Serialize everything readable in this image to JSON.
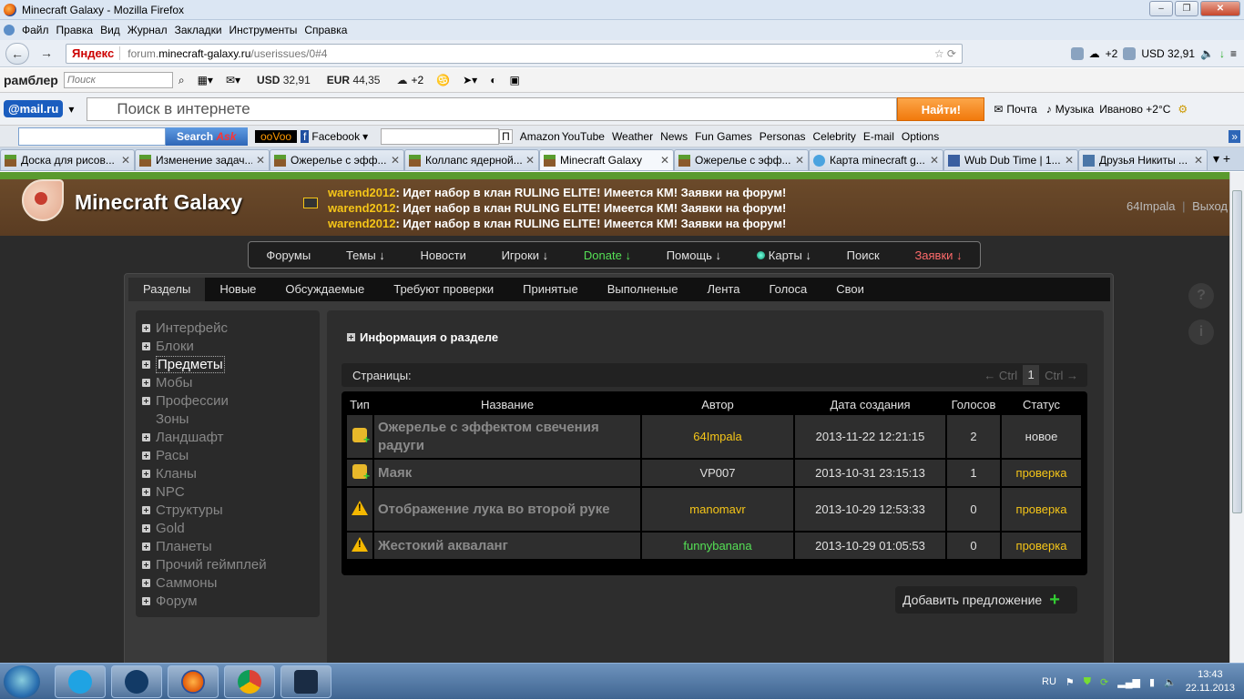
{
  "window": {
    "title": "Minecraft Galaxy - Mozilla Firefox"
  },
  "menu": [
    "Файл",
    "Правка",
    "Вид",
    "Журнал",
    "Закладки",
    "Инструменты",
    "Справка"
  ],
  "nav": {
    "yandex_label": "Яндекс",
    "url_prefix": "forum.",
    "url_host": "minecraft-galaxy.ru",
    "url_path": "/userissues/0#4",
    "right_weather": "+2",
    "right_currency": "USD 32,91"
  },
  "rambler": {
    "logo": "рамблер",
    "search_placeholder": "Поиск",
    "usd_label": "USD",
    "usd_value": "32,91",
    "eur_label": "EUR",
    "eur_value": "44,35",
    "weather": "+2"
  },
  "mailbar": {
    "logo": "@mail.ru",
    "search_placeholder": "Поиск в интернете",
    "find_button": "Найти!",
    "mail": "Почта",
    "music": "Музыка",
    "weather": "Иваново +2°C"
  },
  "searchbar": {
    "search_button": "Search",
    "ask_label": "Ask",
    "facebook": "Facebook",
    "p_label": "П",
    "amazon": "Amazon",
    "youtube": "YouTube",
    "weather": "Weather",
    "news": "News",
    "fun_games": "Fun Games",
    "personas": "Personas",
    "celebrity": "Celebrity",
    "email": "E-mail",
    "options": "Options"
  },
  "tabs": [
    {
      "title": "Доска для рисов..."
    },
    {
      "title": "Изменение задач..."
    },
    {
      "title": "Ожерелье с эфф..."
    },
    {
      "title": "Коллапс ядерной..."
    },
    {
      "title": "Minecraft Galaxy"
    },
    {
      "title": "Ожерелье с эфф..."
    },
    {
      "title": "Карта minecraft g..."
    },
    {
      "title": "Wub Dub Time | 1..."
    },
    {
      "title": "Друзья Никиты ..."
    }
  ],
  "site": {
    "name": "Minecraft Galaxy",
    "news": [
      {
        "author": "warend2012",
        "text": ": Идет набор в клан RULING ELITE! Имеется КМ! Заявки на форум!"
      },
      {
        "author": "warend2012",
        "text": ": Идет набор в клан RULING ELITE! Имеется КМ! Заявки на форум!"
      },
      {
        "author": "warend2012",
        "text": ": Идет набор в клан RULING ELITE! Имеется КМ! Заявки на форум!"
      }
    ],
    "user": "64Impala",
    "sep": "|",
    "logout": "Выход"
  },
  "mainnav": {
    "forums": "Форумы",
    "topics": "Темы ↓",
    "news": "Новости",
    "players": "Игроки ↓",
    "donate": "Donate ↓",
    "help": "Помощь ↓",
    "maps": "Карты ↓",
    "search": "Поиск",
    "requests": "Заявки ↓"
  },
  "sidebtns": {
    "help": "?",
    "info": "i"
  },
  "subtabs": [
    "Разделы",
    "Новые",
    "Обсуждаемые",
    "Требуют проверки",
    "Принятые",
    "Выполненые",
    "Лента",
    "Голоса",
    "Свои"
  ],
  "categories": [
    {
      "label": "Интерфейс",
      "icon": true
    },
    {
      "label": "Блоки",
      "icon": true
    },
    {
      "label": "Предметы",
      "icon": true
    },
    {
      "label": "Мобы",
      "icon": true
    },
    {
      "label": "Профессии",
      "icon": true
    },
    {
      "label": "Зоны",
      "icon": false
    },
    {
      "label": "Ландшафт",
      "icon": true
    },
    {
      "label": "Расы",
      "icon": true
    },
    {
      "label": "Кланы",
      "icon": true
    },
    {
      "label": "NPC",
      "icon": true
    },
    {
      "label": "Структуры",
      "icon": true
    },
    {
      "label": "Gold",
      "icon": true
    },
    {
      "label": "Планеты",
      "icon": true
    },
    {
      "label": "Прочий геймплей",
      "icon": true
    },
    {
      "label": "Саммоны",
      "icon": true
    },
    {
      "label": "Форум",
      "icon": true
    }
  ],
  "section_info": "Информация о разделе",
  "pager": {
    "label": "Страницы:",
    "prev": "← Ctrl",
    "current": "1",
    "next": "Ctrl →"
  },
  "table": {
    "headers": {
      "type": "Тип",
      "name": "Название",
      "author": "Автор",
      "date": "Дата создания",
      "votes": "Голосов",
      "status": "Статус"
    },
    "rows": [
      {
        "icon": "puzzle-icon",
        "name": "Ожерелье с эффектом свечения радуги",
        "author": "64Impala",
        "author_color": "yellow",
        "date": "2013-11-22 12:21:15",
        "votes": "2",
        "status": "новое",
        "status_color": "white"
      },
      {
        "icon": "puzzle-icon",
        "name": "Маяк",
        "author": "VP007",
        "author_color": "white",
        "date": "2013-10-31 23:15:13",
        "votes": "1",
        "status": "проверка",
        "status_color": "yellow"
      },
      {
        "icon": "warning-icon",
        "name": "Отображение лука во второй руке",
        "author": "manomavr",
        "author_color": "yellow",
        "date": "2013-10-29 12:53:33",
        "votes": "0",
        "status": "проверка",
        "status_color": "yellow"
      },
      {
        "icon": "warning-icon",
        "name": "Жестокий акваланг",
        "author": "funnybanana",
        "author_color": "green",
        "date": "2013-10-29 01:05:53",
        "votes": "0",
        "status": "проверка",
        "status_color": "yellow"
      }
    ]
  },
  "add_button": "Добавить предложение",
  "taskbar": {
    "lang": "RU",
    "time": "13:43",
    "date": "22.11.2013"
  },
  "colors": {
    "accent_yellow": "#f5c518",
    "accent_green": "#55e055",
    "accent_red": "#ff6b6b"
  }
}
